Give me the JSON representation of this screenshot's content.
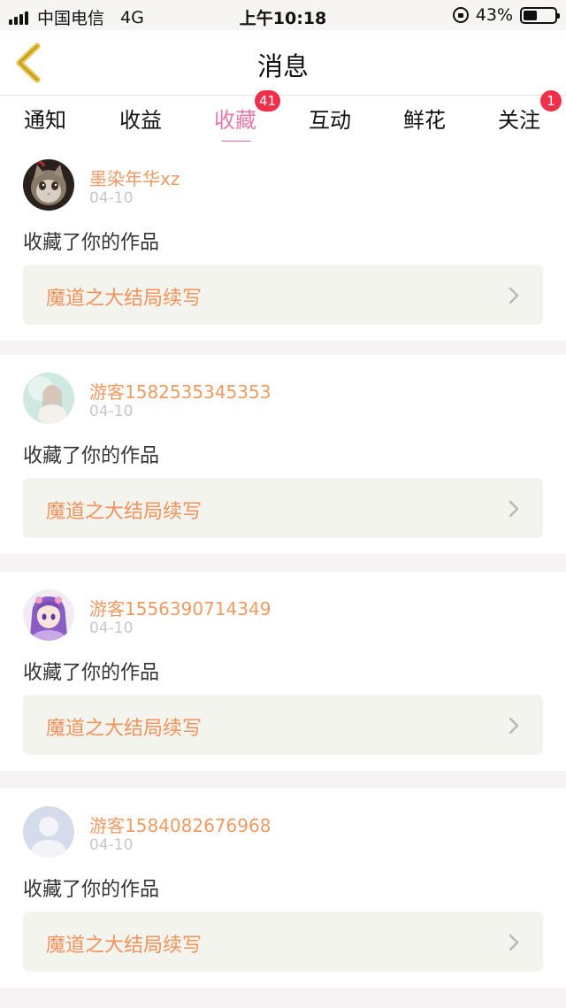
{
  "status_bar": {
    "carrier": "中国电信",
    "network": "4G",
    "time": "上午10:18",
    "battery_percent": "43%",
    "battery_level": 0.43
  },
  "nav": {
    "title": "消息",
    "back_icon": "back-chevron-icon"
  },
  "tabs": [
    {
      "label": "通知",
      "badge": ""
    },
    {
      "label": "收益",
      "badge": ""
    },
    {
      "label": "收藏",
      "badge": "41",
      "active": true
    },
    {
      "label": "互动",
      "badge": ""
    },
    {
      "label": "鲜花",
      "badge": ""
    },
    {
      "label": "关注",
      "badge": "1"
    }
  ],
  "feed": [
    {
      "username": "墨染年华xz",
      "date": "04-10",
      "action": "收藏了你的作品",
      "work_title": "魔道之大结局续写",
      "avatar": "cat-avatar-icon"
    },
    {
      "username": "游客1582535345353",
      "date": "04-10",
      "action": "收藏了你的作品",
      "work_title": "魔道之大结局续写",
      "avatar": "girl-photo-avatar-icon"
    },
    {
      "username": "游客1556390714349",
      "date": "04-10",
      "action": "收藏了你的作品",
      "work_title": "魔道之大结局续写",
      "avatar": "anime-girl-avatar-icon"
    },
    {
      "username": "游客1584082676968",
      "date": "04-10",
      "action": "收藏了你的作品",
      "work_title": "魔道之大结局续写",
      "avatar": "default-user-avatar-icon"
    }
  ],
  "colors": {
    "accent_pink": "#e57aa6",
    "badge_red": "#f0304a",
    "username_orange": "#f09a62",
    "work_title_orange": "#f0925a",
    "back_icon_yellow": "#e8c340"
  }
}
